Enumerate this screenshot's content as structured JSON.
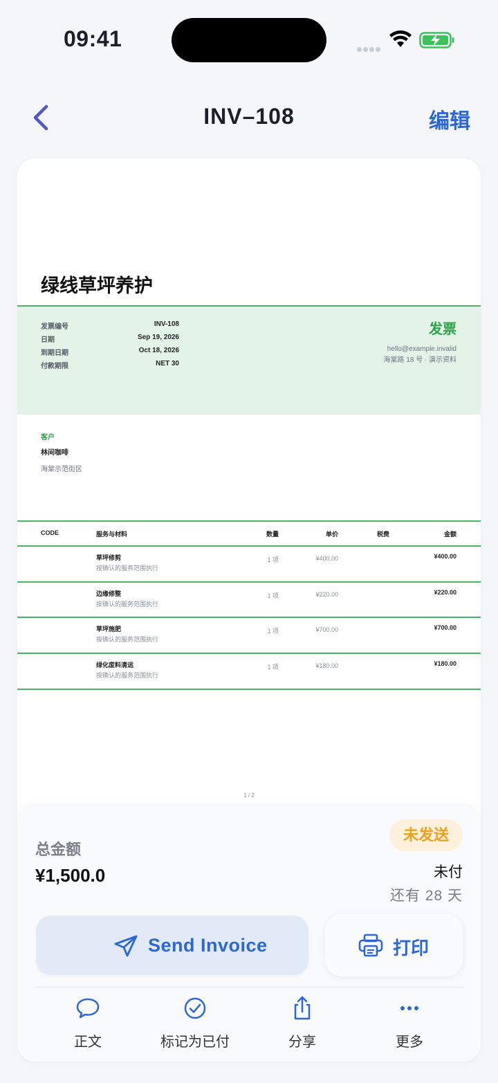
{
  "status_bar": {
    "time": "09:41"
  },
  "nav": {
    "title": "INV–108",
    "edit_label": "编辑"
  },
  "invoice": {
    "company": "绿线草坪养护",
    "label": "发票",
    "meta": [
      {
        "key": "发票编号",
        "value": "INV-108"
      },
      {
        "key": "日期",
        "value": "Sep 19, 2026"
      },
      {
        "key": "到期日期",
        "value": "Oct 18, 2026"
      },
      {
        "key": "付款期限",
        "value": "NET 30"
      }
    ],
    "contact_email": "hello@example.invalid",
    "contact_address": "海棠路 18 号 · 演示资料",
    "client_label": "客户",
    "client_name": "林间咖啡",
    "client_address": "海棠示范街区",
    "table_headers": {
      "code": "CODE",
      "items": "服务与材料",
      "qty": "数量",
      "price": "单价",
      "tax": "税费",
      "amount": "金额"
    },
    "rows": [
      {
        "name": "草坪修剪",
        "desc": "按确认的服务范围执行",
        "qty": "1 项",
        "price": "¥400.00",
        "amount": "¥400.00"
      },
      {
        "name": "边缘修整",
        "desc": "按确认的服务范围执行",
        "qty": "1 项",
        "price": "¥220.00",
        "amount": "¥220.00"
      },
      {
        "name": "草坪施肥",
        "desc": "按确认的服务范围执行",
        "qty": "1 项",
        "price": "¥700.00",
        "amount": "¥700.00"
      },
      {
        "name": "绿化废料清运",
        "desc": "按确认的服务范围执行",
        "qty": "1 项",
        "price": "¥180.00",
        "amount": "¥180.00"
      }
    ],
    "page_indicator": "1 / 2"
  },
  "summary": {
    "total_label": "总金额",
    "total_value": "¥1,500.0",
    "status_badge": "未发送",
    "payment_status": "未付",
    "due_in": "还有 28 天"
  },
  "actions": {
    "send_label": "Send Invoice",
    "print_label": "打印"
  },
  "tabs": [
    {
      "label": "正文",
      "icon": "chat-bubble-icon"
    },
    {
      "label": "标记为已付",
      "icon": "check-circle-icon"
    },
    {
      "label": "分享",
      "icon": "share-icon"
    },
    {
      "label": "更多",
      "icon": "more-icon"
    }
  ],
  "colors": {
    "accent": "#2b68d6",
    "invoice_green": "#2aa44a",
    "badge_orange": "#eea020"
  }
}
